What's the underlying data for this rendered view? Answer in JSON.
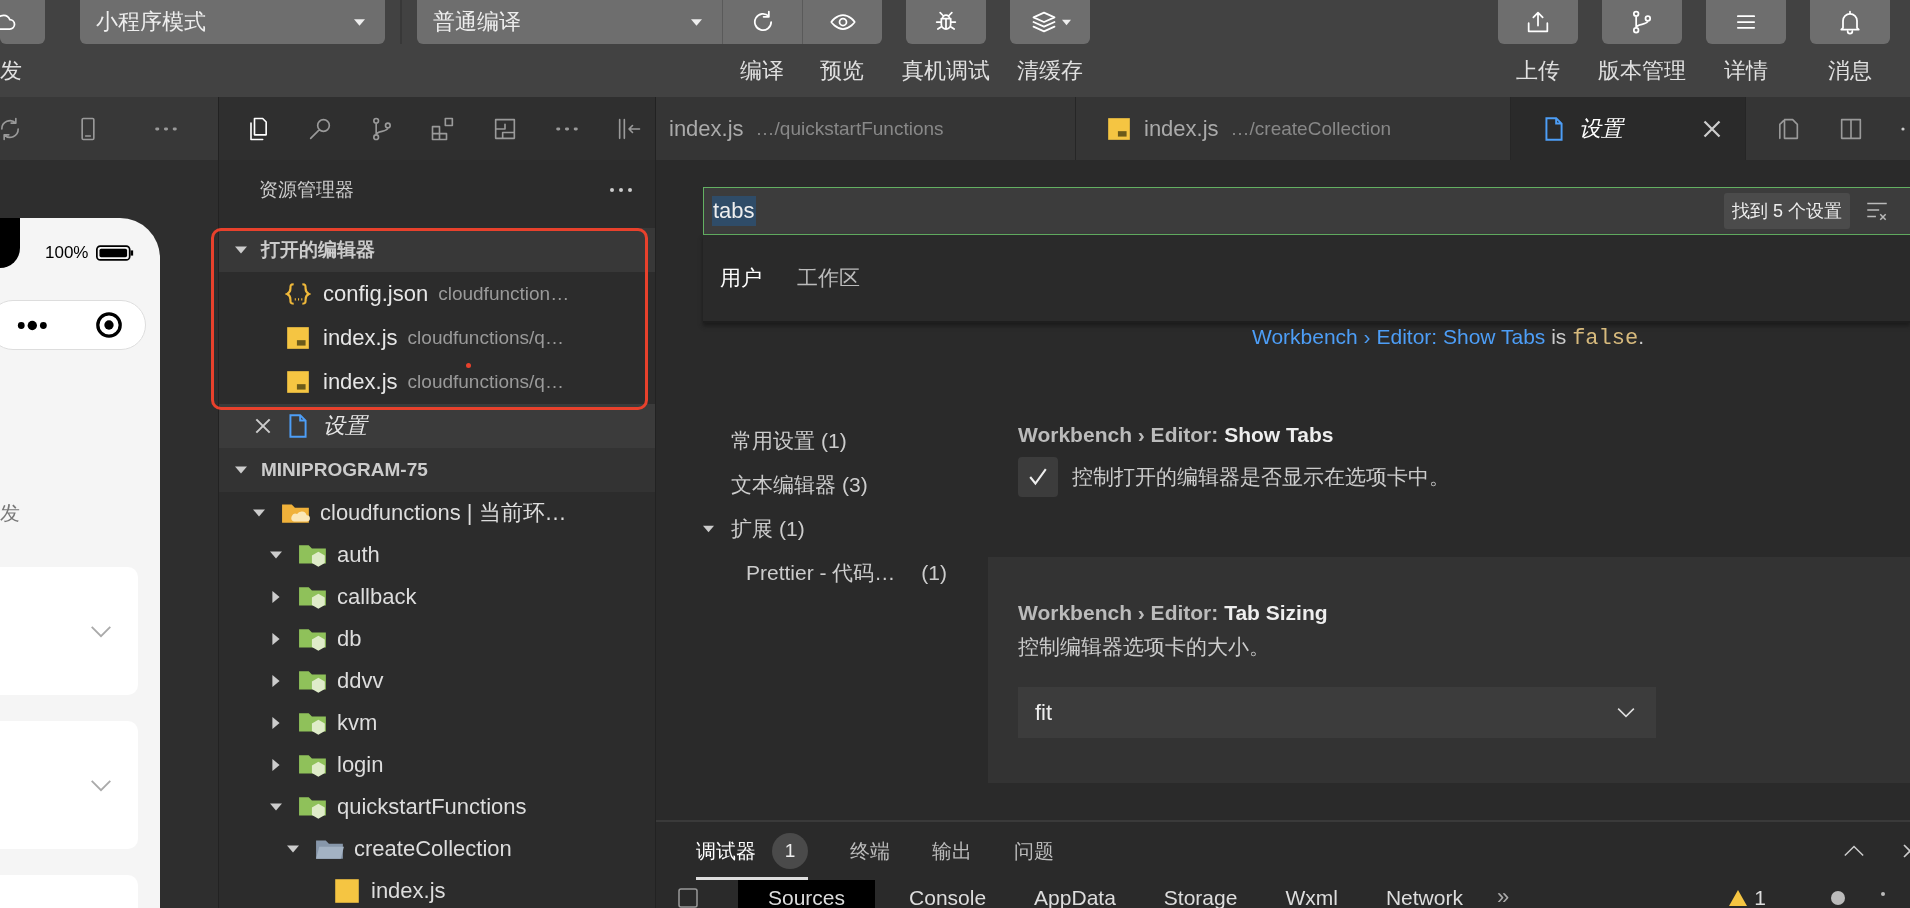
{
  "toolbar": {
    "left_label": "发",
    "mode_select": "小程序模式",
    "compile_select": "普通编译",
    "actions": [
      {
        "kind": "refresh",
        "label": "编译"
      },
      {
        "kind": "eye",
        "label": "预览"
      }
    ],
    "tools": [
      {
        "kind": "bug",
        "label": "真机调试"
      },
      {
        "kind": "layers",
        "label": "清缓存"
      }
    ],
    "right": [
      {
        "kind": "upload",
        "label": "上传"
      },
      {
        "kind": "branch",
        "label": "版本管理"
      },
      {
        "kind": "menu",
        "label": "详情"
      },
      {
        "kind": "bell",
        "label": "消息"
      }
    ]
  },
  "simulator": {
    "battery": "100%",
    "page_text": "发"
  },
  "explorer": {
    "title": "资源管理器",
    "open_editors": {
      "title": "打开的编辑器",
      "expanded": true,
      "items": [
        {
          "name": "config.json",
          "path": "cloudfunction…",
          "kind": "json",
          "selected": false
        },
        {
          "name": "index.js",
          "path": "cloudfunctions/q…",
          "kind": "js",
          "selected": false
        },
        {
          "name": "index.js",
          "path": "cloudfunctions/q…",
          "kind": "js",
          "selected": false
        },
        {
          "name": "设置",
          "kind": "settings",
          "selected": true
        }
      ]
    },
    "project": {
      "title": "MINIPROGRAM-75",
      "expanded": true,
      "children": [
        {
          "name": "cloudfunctions | 当前环…",
          "kind": "cloud-folder",
          "expanded": true,
          "children": [
            {
              "name": "auth",
              "kind": "function-folder",
              "expanded": true
            },
            {
              "name": "callback",
              "kind": "function-folder",
              "expanded": false
            },
            {
              "name": "db",
              "kind": "function-folder",
              "expanded": false
            },
            {
              "name": "ddvv",
              "kind": "function-folder",
              "expanded": false
            },
            {
              "name": "kvm",
              "kind": "function-folder",
              "expanded": false
            },
            {
              "name": "login",
              "kind": "function-folder",
              "expanded": false
            },
            {
              "name": "quickstartFunctions",
              "kind": "function-folder",
              "expanded": true,
              "children": [
                {
                  "name": "createCollection",
                  "kind": "folder",
                  "expanded": true,
                  "children": [
                    {
                      "name": "index.js",
                      "kind": "js"
                    }
                  ]
                }
              ]
            }
          ]
        }
      ]
    }
  },
  "editor_tabs": [
    {
      "file": "index.js",
      "path": "…/quickstartFunctions",
      "kind": "text",
      "selected": false
    },
    {
      "file": "index.js",
      "path": "…/createCollection",
      "kind": "js",
      "selected": false
    },
    {
      "file": "设置",
      "kind": "settings",
      "selected": true
    }
  ],
  "settings": {
    "search": {
      "value": "tabs",
      "result": "找到 5 个设置"
    },
    "scopes": [
      {
        "label": "用户",
        "selected": true
      },
      {
        "label": "工作区",
        "selected": false
      }
    ],
    "notice": {
      "link": "Workbench › Editor: Show Tabs",
      "text": "is",
      "value": "false",
      "end": "."
    },
    "toc": [
      {
        "label": "常用设置",
        "count": "(1)"
      },
      {
        "label": "文本编辑器",
        "count": "(3)"
      },
      {
        "label": "扩展",
        "count": "(1)",
        "expanded": true,
        "children": [
          {
            "label": "Prettier - 代码…",
            "count": "(1)"
          }
        ]
      }
    ],
    "items": [
      {
        "kind": "checkbox",
        "category": "Workbench › Editor:",
        "name": "Show Tabs",
        "description": "控制打开的编辑器是否显示在选项卡中。",
        "checked": true,
        "focused": false
      },
      {
        "kind": "select",
        "category": "Workbench › Editor:",
        "name": "Tab Sizing",
        "description": "控制编辑器选项卡的大小。",
        "value": "fit",
        "focused": true
      }
    ]
  },
  "panel": {
    "tabs": [
      {
        "label": "调试器",
        "badge": "1",
        "selected": true
      },
      {
        "label": "终端",
        "selected": false
      },
      {
        "label": "输出",
        "selected": false
      },
      {
        "label": "问题",
        "selected": false
      }
    ],
    "devtools": [
      {
        "label": "Sources",
        "selected": true
      },
      {
        "label": "Console",
        "selected": false
      },
      {
        "label": "AppData",
        "selected": false
      },
      {
        "label": "Storage",
        "selected": false
      },
      {
        "label": "Wxml",
        "selected": false
      },
      {
        "label": "Network",
        "selected": false
      }
    ],
    "more": "»",
    "warnings": "1"
  }
}
